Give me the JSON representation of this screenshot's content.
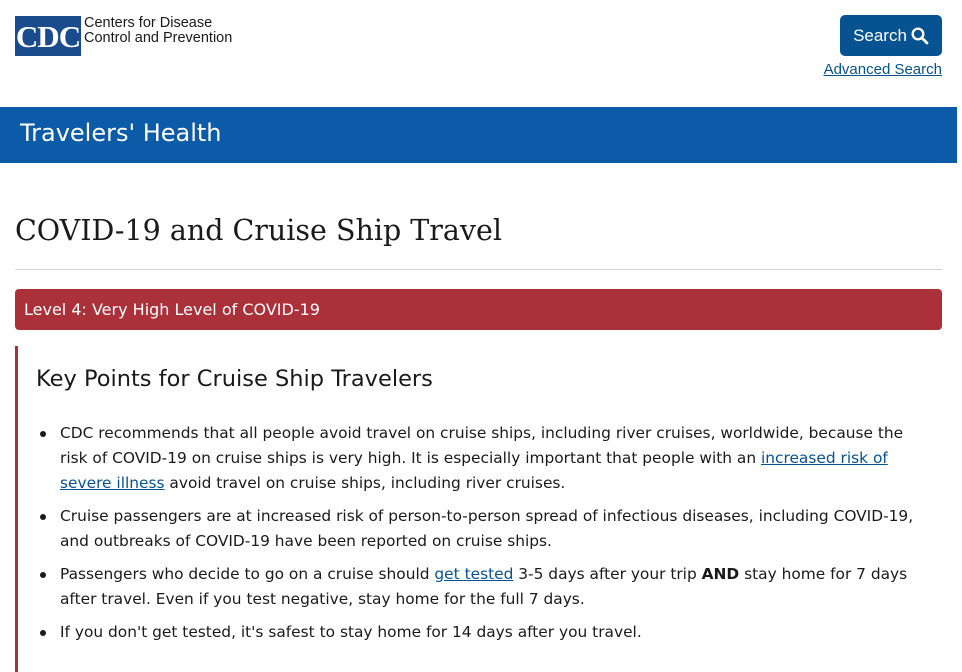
{
  "header": {
    "logo_mark": "CDC",
    "org_line1": "Centers for Disease",
    "org_line2": "Control and Prevention",
    "search_label": "Search",
    "advanced_search": "Advanced Search"
  },
  "banner": {
    "title": "Travelers' Health"
  },
  "page": {
    "title": "COVID-19 and Cruise Ship Travel"
  },
  "alert": {
    "text": "Level 4: Very High Level of COVID-19"
  },
  "key_points": {
    "heading": "Key Points for Cruise Ship Travelers",
    "p1": {
      "before": "CDC recommends that all people avoid travel on cruise ships, including river cruises, worldwide, because the risk of COVID-19 on cruise ships is very high. It is especially important that people with an ",
      "link": "increased risk of severe illness",
      "after": " avoid travel on cruise ships, including river cruises."
    },
    "p2": {
      "text": "Cruise passengers are at increased risk of person-to-person spread of infectious diseases, including COVID-19, and outbreaks of COVID-19 have been reported on cruise ships."
    },
    "p3": {
      "before": "Passengers who decide to go on a cruise should ",
      "link": "get tested",
      "middle": " 3-5 days after your trip ",
      "bold": "AND",
      "after": " stay home for 7 days after travel. Even if you test negative, stay home for the full 7 days."
    },
    "p4": {
      "text": "If you don't get tested, it's safest to stay home for 14 days after you travel."
    }
  },
  "colors": {
    "brand_blue": "#075290",
    "banner_blue": "#0c5ba8",
    "alert_red": "#aa3139"
  },
  "icons": {
    "search": "magnifier-icon"
  }
}
